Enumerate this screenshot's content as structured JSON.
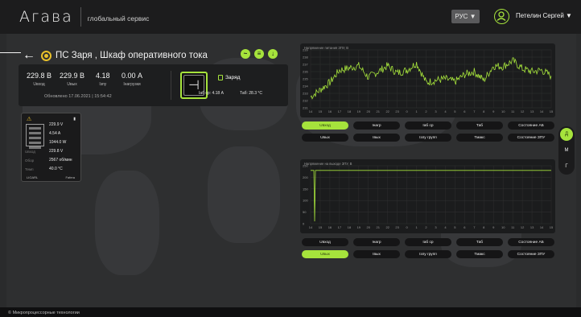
{
  "header": {
    "logo": "Агава",
    "service": "глобальный сервис",
    "lang": "РУС ▼",
    "user": "Петелин Сергей ▼"
  },
  "object": {
    "title": "ПС Заря , Шкаф оперативного тока"
  },
  "stats": [
    {
      "value": "229.8 В",
      "label": "Uвход"
    },
    {
      "value": "229.9 В",
      "label": "Uвых"
    },
    {
      "value": "4.18",
      "label": "Iзпу"
    },
    {
      "value": "0.00 А",
      "label": "Iнагрузки"
    }
  ],
  "updated": "Обновлено  17.06.2021 | 15:54:42",
  "charge": {
    "label": "Заряд",
    "iab": "Iаб ср: 4.18 А",
    "tab": "Таб: 28.3 °С"
  },
  "device": {
    "rows": [
      "229.9 V",
      "4.54 A",
      "1044.0 W",
      "229.8 V",
      "2567 об/мин",
      "40.0 °С"
    ],
    "labels": [
      "Uвых",
      "Iвых",
      "Pвых",
      "Uвход",
      "Обор",
      "Темп"
    ],
    "foot_left": "LIGARL",
    "foot_right": "Fafera"
  },
  "chart1": {
    "title": "Напряжение питания ЗПУ, В",
    "buttons": [
      "Uвход",
      "Iнагр",
      "Iаб ср",
      "Таб",
      "Состояние АБ",
      "Uвых",
      "Iвых",
      "Iзпу групп",
      "Тмакс",
      "Состояние ЗПУ"
    ],
    "active": "Uвход"
  },
  "chart2": {
    "title": "Напряжение на выходе ЗПУ, В",
    "buttons": [
      "Uвход",
      "Iнагр",
      "Iаб ср",
      "Таб",
      "Состояние АБ",
      "Uвых",
      "Iвых",
      "Iзпу групп",
      "Тмакс",
      "Состояние ЗПУ"
    ],
    "active": "Uвых"
  },
  "chart_data": [
    {
      "type": "line",
      "title": "Напряжение питания ЗПУ, В",
      "x": [
        "14",
        "15",
        "16",
        "17",
        "18",
        "19",
        "20",
        "21",
        "22",
        "23",
        "0",
        "1",
        "2",
        "3",
        "4",
        "5",
        "6",
        "7",
        "8",
        "9",
        "10",
        "11",
        "12",
        "13",
        "14",
        "15"
      ],
      "y_ticks": [
        231,
        232,
        233,
        234,
        235,
        236,
        237,
        238,
        239
      ],
      "ylim": [
        231,
        239
      ],
      "series": [
        {
          "values": [
            232.5,
            233.5,
            234.5,
            236.2,
            236.5,
            236.8,
            235.2,
            236.0,
            236.8,
            235.8,
            236.2,
            237.2,
            234.5,
            234.8,
            235.0,
            234.6,
            235.6,
            236.0,
            234.8,
            236.8,
            236.7,
            237.5,
            236.4,
            236.0,
            236.2,
            235.4
          ]
        }
      ]
    },
    {
      "type": "line",
      "title": "Напряжение на выходе ЗПУ, В",
      "x": [
        "14",
        "15",
        "16",
        "17",
        "18",
        "19",
        "20",
        "21",
        "22",
        "23",
        "0",
        "1",
        "2",
        "3",
        "4",
        "5",
        "6",
        "7",
        "8",
        "9",
        "10",
        "11",
        "12",
        "13",
        "14",
        "15"
      ],
      "y_ticks": [
        0,
        50,
        100,
        150,
        200,
        250
      ],
      "ylim": [
        0,
        250
      ],
      "series": [
        {
          "values": [
            229.9,
            10,
            229.9,
            229.9,
            229.9,
            229.9,
            229.9,
            229.9,
            229.9,
            229.9,
            229.9,
            229.9,
            229.9,
            229.9,
            229.9,
            229.9,
            229.9,
            229.9,
            229.9,
            229.9,
            229.9,
            229.9,
            229.9,
            229.9,
            229.9,
            229.9
          ]
        }
      ]
    }
  ],
  "side": [
    "Д",
    "М",
    "Г"
  ],
  "footer": "© Микропроцессорные технологии"
}
